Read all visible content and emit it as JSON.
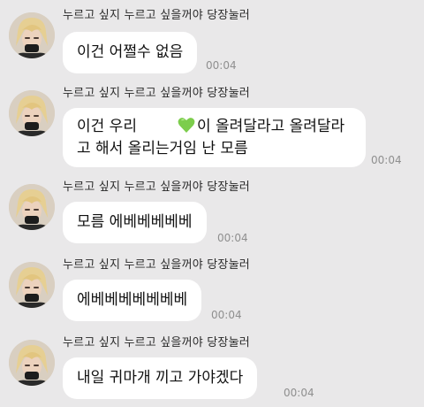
{
  "chat": {
    "messages": [
      {
        "sender": "누르고 싶지 누르고 싶을꺼야 당장눌러",
        "lines": [
          "이건 어쩔수 없음"
        ],
        "time": "00:04",
        "avatar_icon": "profile-photo"
      },
      {
        "sender": "누르고 싶지 누르고 싶을꺼야 당장눌러",
        "line1_before": "이건 우리",
        "line1_after": "이 올려달라고 올려달라",
        "line2": "고 해서 올리는거임 난 모름",
        "heart_icon": "green-heart-emoji",
        "heart_color": "#7ccd4c",
        "time": "00:04",
        "avatar_icon": "profile-photo"
      },
      {
        "sender": "누르고 싶지 누르고 싶을꺼야 당장눌러",
        "lines": [
          "모름 에베베베베베"
        ],
        "time": "00:04",
        "avatar_icon": "profile-photo"
      },
      {
        "sender": "누르고 싶지 누르고 싶을꺼야 당장눌러",
        "lines": [
          "에베베베베베베베"
        ],
        "time": "00:04",
        "avatar_icon": "profile-photo"
      },
      {
        "sender": "누르고 싶지 누르고 싶을꺼야 당장눌러",
        "lines": [
          "내일 귀마개 끼고 가야겠다"
        ],
        "time": "00:04",
        "avatar_icon": "profile-photo"
      }
    ]
  },
  "colors": {
    "background": "#e9e8e9",
    "bubble": "#ffffff",
    "timestamp": "#8f8f8f"
  }
}
